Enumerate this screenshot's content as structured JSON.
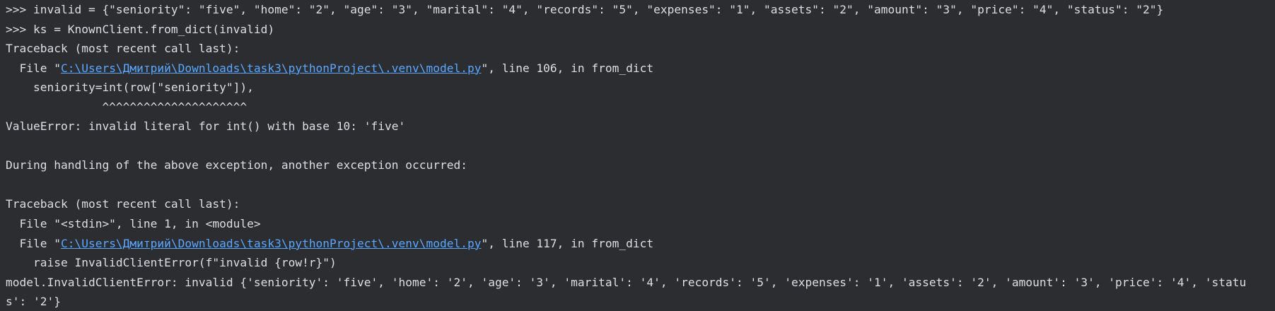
{
  "console": {
    "lines": [
      {
        "text": ">>> invalid = {\"seniority\": \"five\", \"home\": \"2\", \"age\": \"3\", \"marital\": \"4\", \"records\": \"5\", \"expenses\": \"1\", \"assets\": \"2\", \"amount\": \"3\", \"price\": \"4\", \"status\": \"2\"}"
      },
      {
        "text": ">>> ks = KnownClient.from_dict(invalid)"
      },
      {
        "text": "Traceback (most recent call last):"
      },
      {
        "pre": "  File \"",
        "link": "C:\\Users\\Дмитрий\\Downloads\\task3\\pythonProject\\.venv\\model.py",
        "post": "\", line 106, in from_dict"
      },
      {
        "text": "    seniority=int(row[\"seniority\"]),"
      },
      {
        "text": "              ^^^^^^^^^^^^^^^^^^^^^"
      },
      {
        "text": "ValueError: invalid literal for int() with base 10: 'five'"
      },
      {
        "text": ""
      },
      {
        "text": "During handling of the above exception, another exception occurred:"
      },
      {
        "text": ""
      },
      {
        "text": "Traceback (most recent call last):"
      },
      {
        "text": "  File \"<stdin>\", line 1, in <module>"
      },
      {
        "pre": "  File \"",
        "link": "C:\\Users\\Дмитрий\\Downloads\\task3\\pythonProject\\.venv\\model.py",
        "post": "\", line 117, in from_dict"
      },
      {
        "text": "    raise InvalidClientError(f\"invalid {row!r}\")"
      },
      {
        "text": "model.InvalidClientError: invalid {'seniority': 'five', 'home': '2', 'age': '3', 'marital': '4', 'records': '5', 'expenses': '1', 'assets': '2', 'amount': '3', 'price': '4', 'statu"
      },
      {
        "text": "s': '2'}"
      }
    ]
  }
}
